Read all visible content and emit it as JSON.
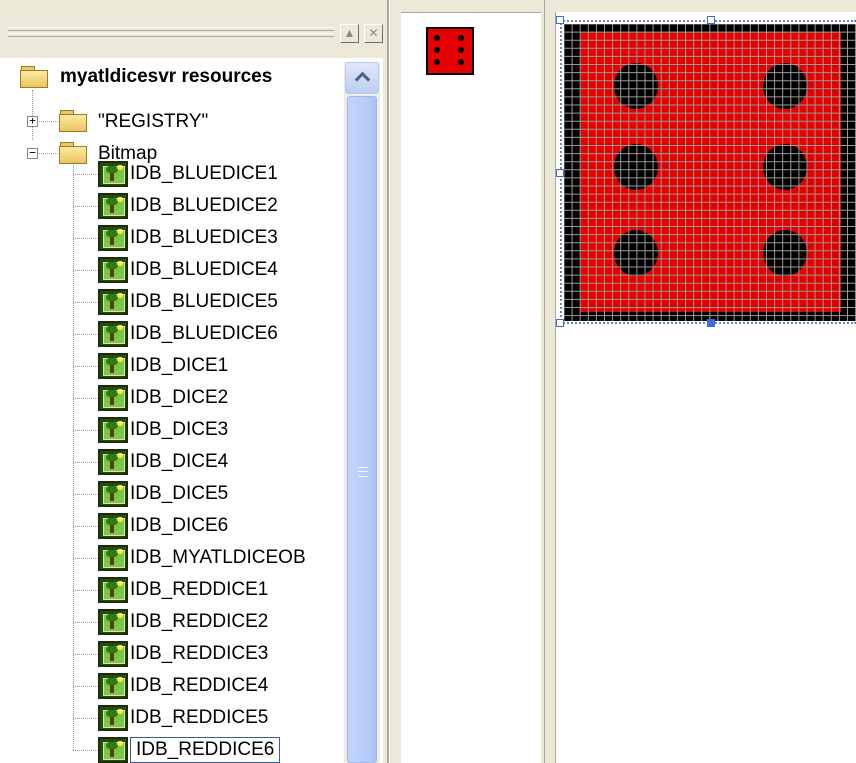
{
  "tree": {
    "root": {
      "label": "myatldicesvr resources"
    },
    "folders": [
      {
        "label": "\"REGISTRY\"",
        "expander": "+"
      },
      {
        "label": "Bitmap",
        "expander": "−"
      }
    ],
    "items": [
      {
        "label": "IDB_BLUEDICE1"
      },
      {
        "label": "IDB_BLUEDICE2"
      },
      {
        "label": "IDB_BLUEDICE3"
      },
      {
        "label": "IDB_BLUEDICE4"
      },
      {
        "label": "IDB_BLUEDICE5"
      },
      {
        "label": "IDB_BLUEDICE6"
      },
      {
        "label": "IDB_DICE1"
      },
      {
        "label": "IDB_DICE2"
      },
      {
        "label": "IDB_DICE3"
      },
      {
        "label": "IDB_DICE4"
      },
      {
        "label": "IDB_DICE5"
      },
      {
        "label": "IDB_DICE6"
      },
      {
        "label": "IDB_MYATLDICEOB"
      },
      {
        "label": "IDB_REDDICE1"
      },
      {
        "label": "IDB_REDDICE2"
      },
      {
        "label": "IDB_REDDICE3"
      },
      {
        "label": "IDB_REDDICE4"
      },
      {
        "label": "IDB_REDDICE5"
      },
      {
        "label": "IDB_REDDICE6"
      }
    ],
    "selected_item": "IDB_REDDICE6"
  },
  "titlebar": {
    "minimize_glyph": "▲",
    "close_glyph": "✕"
  },
  "bitmap": {
    "pip_count": 6,
    "grid_cells": 36,
    "colors": {
      "face": "#e30000",
      "pip": "#000000",
      "border": "#000000",
      "grid": "#9a9a9a"
    }
  }
}
